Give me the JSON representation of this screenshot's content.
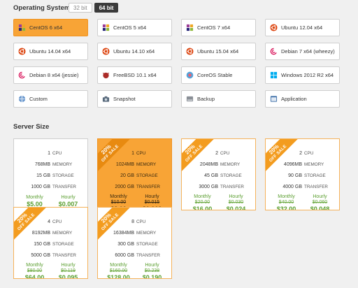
{
  "os_section": {
    "title": "Operating System",
    "bit_options": [
      "32 bit",
      "64 bit"
    ],
    "selected_bit": "64 bit"
  },
  "os_options": [
    {
      "label": "CentOS 6 x64",
      "icon": "centos-icon",
      "selected": true
    },
    {
      "label": "CentOS 5 x64",
      "icon": "centos-icon",
      "selected": false
    },
    {
      "label": "CentOS 7 x64",
      "icon": "centos-icon",
      "selected": false
    },
    {
      "label": "Ubuntu 12.04 x64",
      "icon": "ubuntu-icon",
      "selected": false
    },
    {
      "label": "Ubuntu 14.04 x64",
      "icon": "ubuntu-icon",
      "selected": false
    },
    {
      "label": "Ubuntu 14.10 x64",
      "icon": "ubuntu-icon",
      "selected": false
    },
    {
      "label": "Ubuntu 15.04 x64",
      "icon": "ubuntu-icon",
      "selected": false
    },
    {
      "label": "Debian 7 x64 (wheezy)",
      "icon": "debian-icon",
      "selected": false
    },
    {
      "label": "Debian 8 x64 (jessie)",
      "icon": "debian-icon",
      "selected": false
    },
    {
      "label": "FreeBSD 10.1 x64",
      "icon": "freebsd-icon",
      "selected": false
    },
    {
      "label": "CoreOS Stable",
      "icon": "coreos-icon",
      "selected": false
    },
    {
      "label": "Windows 2012 R2 x64",
      "icon": "windows-icon",
      "selected": false
    },
    {
      "label": "Custom",
      "icon": "globe-icon",
      "selected": false
    },
    {
      "label": "Snapshot",
      "icon": "camera-icon",
      "selected": false
    },
    {
      "label": "Backup",
      "icon": "drive-icon",
      "selected": false
    },
    {
      "label": "Application",
      "icon": "application-icon",
      "selected": false
    }
  ],
  "size_section": {
    "title": "Server Size",
    "unit_labels": {
      "cpu": "CPU",
      "memory": "MEMORY",
      "storage": "STORAGE",
      "transfer": "TRANSFER"
    },
    "price_labels": {
      "monthly": "Monthly",
      "hourly": "Hourly"
    }
  },
  "sizes": [
    {
      "cpu": "1",
      "memory": "768MB",
      "storage": "15 GB",
      "transfer": "1000 GB",
      "monthly_old": "",
      "hourly_old": "",
      "monthly": "$5.00",
      "hourly": "$0.007",
      "sale": false,
      "selected": false
    },
    {
      "cpu": "1",
      "memory": "1024MB",
      "storage": "20 GB",
      "transfer": "2000 GB",
      "monthly_old": "$10.00",
      "hourly_old": "$0.015",
      "monthly": "$8.00",
      "hourly": "$0.012",
      "sale": true,
      "selected": true
    },
    {
      "cpu": "2",
      "memory": "2048MB",
      "storage": "45 GB",
      "transfer": "3000 GB",
      "monthly_old": "$20.00",
      "hourly_old": "$0.030",
      "monthly": "$16.00",
      "hourly": "$0.024",
      "sale": true,
      "selected": false
    },
    {
      "cpu": "2",
      "memory": "4096MB",
      "storage": "90 GB",
      "transfer": "4000 GB",
      "monthly_old": "$40.00",
      "hourly_old": "$0.060",
      "monthly": "$32.00",
      "hourly": "$0.048",
      "sale": true,
      "selected": false
    },
    {
      "cpu": "4",
      "memory": "8192MB",
      "storage": "150 GB",
      "transfer": "5000 GB",
      "monthly_old": "$80.00",
      "hourly_old": "$0.119",
      "monthly": "$64.00",
      "hourly": "$0.095",
      "sale": true,
      "selected": false
    },
    {
      "cpu": "8",
      "memory": "16384MB",
      "storage": "300 GB",
      "transfer": "6000 GB",
      "monthly_old": "$160.00",
      "hourly_old": "$0.238",
      "monthly": "$128.00",
      "hourly": "$0.190",
      "sale": true,
      "selected": false
    }
  ],
  "sale_ribbon": {
    "line1": "20%",
    "line2": "OFF SALE"
  },
  "colors": {
    "accent": "#f8a436",
    "price_green": "#5a9e2f",
    "ribbon": "#f39c1f"
  }
}
